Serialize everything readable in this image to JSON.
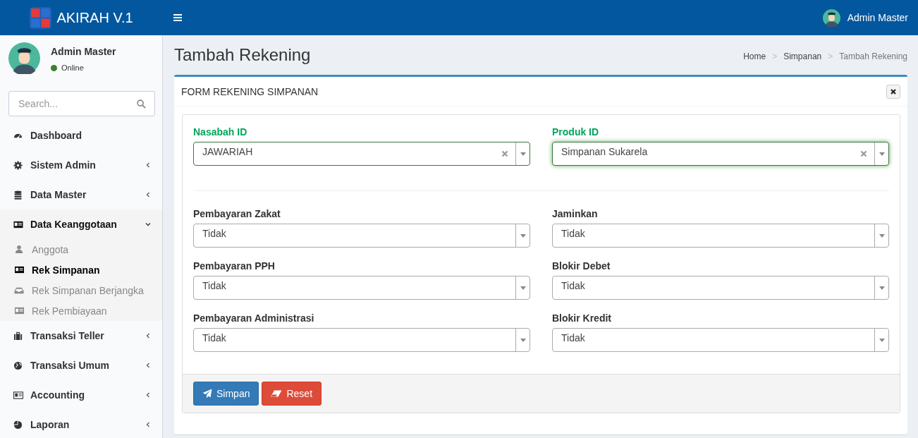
{
  "header": {
    "brand": "AKIRAH V.1",
    "user": "Admin Master"
  },
  "sidebar": {
    "user": {
      "name": "Admin Master",
      "status": "Online",
      "online": true
    },
    "search": {
      "placeholder": "Search..."
    },
    "menu": [
      {
        "label": "Dashboard",
        "has_submenu": false,
        "expanded": false
      },
      {
        "label": "Sistem Admin",
        "has_submenu": true,
        "expanded": false
      },
      {
        "label": "Data Master",
        "has_submenu": true,
        "expanded": false
      },
      {
        "label": "Data Keanggotaan",
        "has_submenu": true,
        "expanded": true,
        "children": [
          {
            "label": "Anggota",
            "selected": false
          },
          {
            "label": "Rek Simpanan",
            "selected": true
          },
          {
            "label": "Rek Simpanan Berjangka",
            "selected": false
          },
          {
            "label": "Rek Pembiayaan",
            "selected": false
          }
        ]
      },
      {
        "label": "Transaksi Teller",
        "has_submenu": true,
        "expanded": false
      },
      {
        "label": "Transaksi Umum",
        "has_submenu": true,
        "expanded": false
      },
      {
        "label": "Accounting",
        "has_submenu": true,
        "expanded": false
      },
      {
        "label": "Laporan",
        "has_submenu": true,
        "expanded": false
      }
    ]
  },
  "page": {
    "title": "Tambah Rekening",
    "breadcrumb": [
      {
        "kind": "link",
        "label": "Home"
      },
      {
        "kind": "separator",
        "label": ">"
      },
      {
        "kind": "link",
        "label": "Simpanan"
      },
      {
        "kind": "separator",
        "label": ">"
      },
      {
        "kind": "current",
        "label": "Tambah Rekening"
      }
    ]
  },
  "card": {
    "title": "FORM REKENING SIMPANAN",
    "top_fields": [
      {
        "label": "Nasabah ID",
        "value": "JAWARIAH",
        "valid": true,
        "clearable": true,
        "focused": false
      },
      {
        "label": "Produk ID",
        "value": "Simpanan Sukarela",
        "valid": true,
        "clearable": true,
        "focused": true
      }
    ],
    "fields": [
      {
        "label": "Pembayaran Zakat",
        "value": "Tidak",
        "valid": false,
        "clearable": false,
        "focused": false
      },
      {
        "label": "Jaminkan",
        "value": "Tidak",
        "valid": false,
        "clearable": false,
        "focused": false
      },
      {
        "label": "Pembayaran PPH",
        "value": "Tidak",
        "valid": false,
        "clearable": false,
        "focused": false
      },
      {
        "label": "Blokir Debet",
        "value": "Tidak",
        "valid": false,
        "clearable": false,
        "focused": false
      },
      {
        "label": "Pembayaran Administrasi",
        "value": "Tidak",
        "valid": false,
        "clearable": false,
        "focused": false
      },
      {
        "label": "Blokir Kredit",
        "value": "Tidak",
        "valid": false,
        "clearable": false,
        "focused": false
      }
    ],
    "buttons": [
      {
        "label": "Simpan",
        "kind": "primary"
      },
      {
        "label": "Reset",
        "kind": "danger"
      }
    ]
  }
}
